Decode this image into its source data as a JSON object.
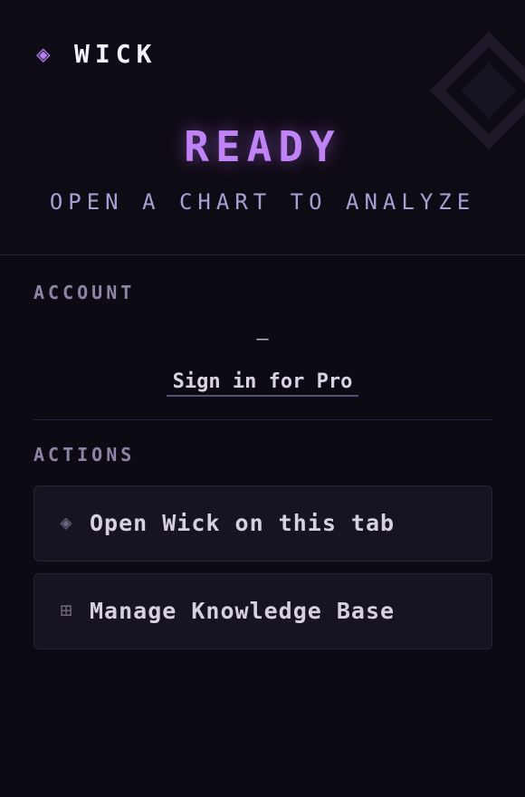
{
  "brand": {
    "icon": "diamond-icon",
    "glyph": "◈",
    "name": "WICK"
  },
  "status": {
    "title": "READY",
    "subtitle": "OPEN A CHART TO ANALYZE"
  },
  "account": {
    "label": "ACCOUNT",
    "value": "—",
    "sign_in_label": "Sign in for Pro"
  },
  "actions": {
    "label": "ACTIONS",
    "items": [
      {
        "icon": "diamond-icon",
        "glyph": "◈",
        "label": "Open Wick on this tab"
      },
      {
        "icon": "squared-plus-icon",
        "glyph": "⊞",
        "label": "Manage Knowledge Base"
      }
    ]
  },
  "colors": {
    "accent": "#c083f5",
    "background": "#0e0a14",
    "button": "#181321"
  }
}
